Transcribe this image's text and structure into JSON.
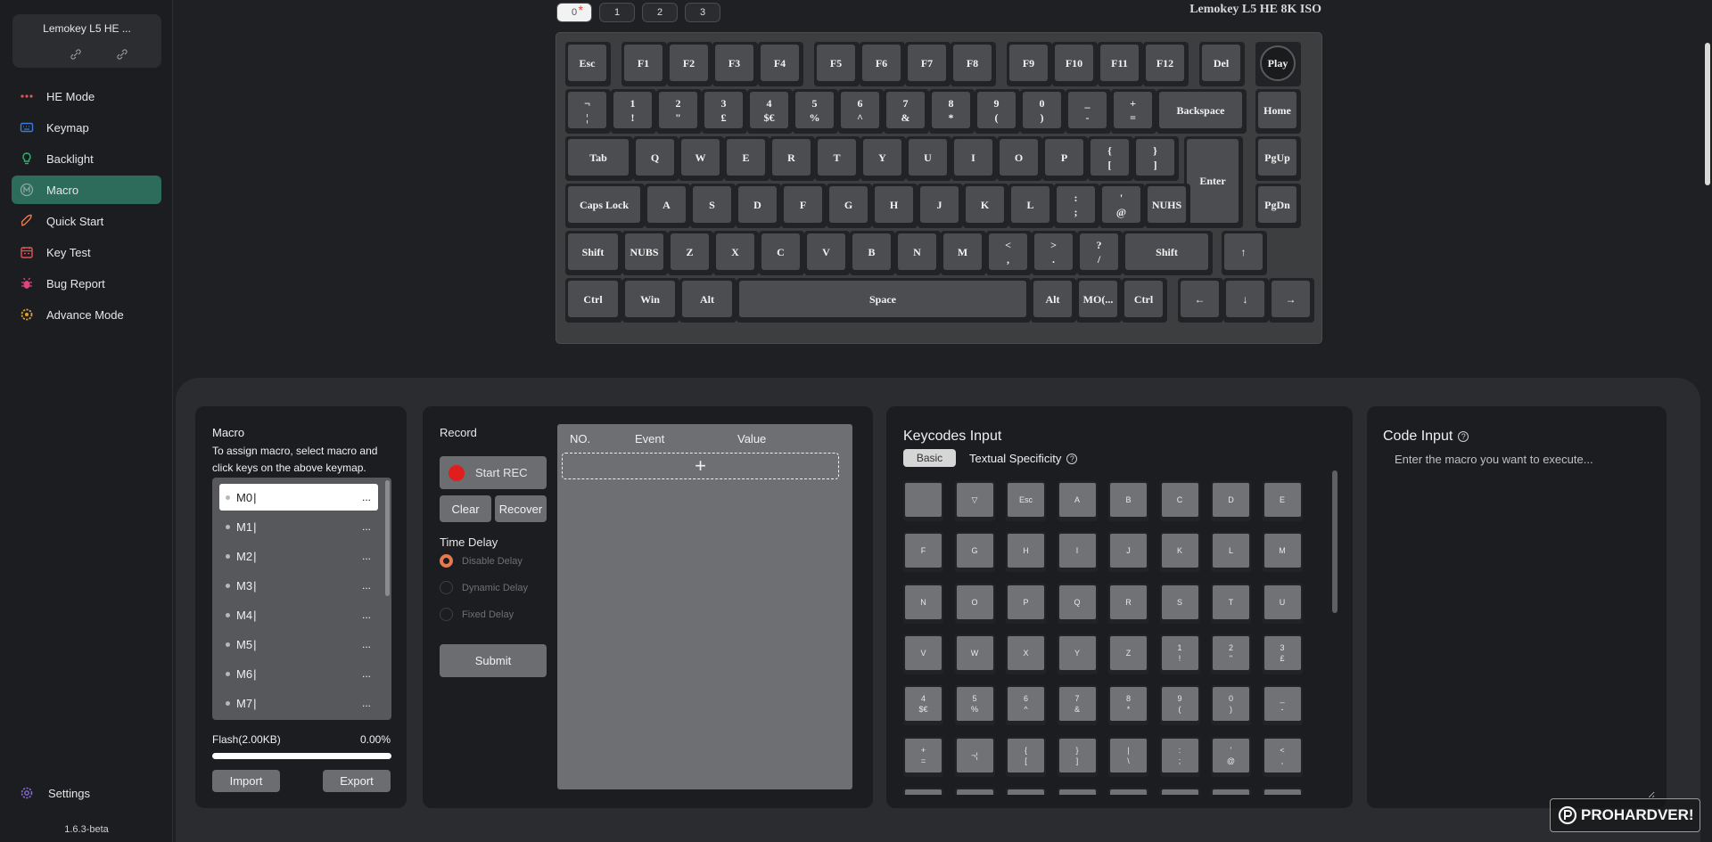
{
  "device": {
    "name": "Lemokey L5 HE ...",
    "link_icon": "link-icon",
    "unlink_icon": "unlink-icon"
  },
  "nav": [
    {
      "label": "HE Mode",
      "icon": "he-mode-icon",
      "color": "#e05555"
    },
    {
      "label": "Keymap",
      "icon": "keymap-icon",
      "color": "#3a7bd5"
    },
    {
      "label": "Backlight",
      "icon": "bulb-icon",
      "color": "#2fb36f"
    },
    {
      "label": "Macro",
      "icon": "macro-icon",
      "color": "#8da89f",
      "active": true
    },
    {
      "label": "Quick Start",
      "icon": "rocket-icon",
      "color": "#e8784e"
    },
    {
      "label": "Key Test",
      "icon": "key-test-icon",
      "color": "#e05555"
    },
    {
      "label": "Bug Report",
      "icon": "bug-icon",
      "color": "#e0447a"
    },
    {
      "label": "Advance Mode",
      "icon": "advance-gear-icon",
      "color": "#e0a030"
    }
  ],
  "settings": {
    "label": "Settings",
    "icon": "settings-icon",
    "color": "#8a6bd5"
  },
  "version": "1.6.3-beta",
  "layers": [
    {
      "label": "0",
      "active": true,
      "modified": true
    },
    {
      "label": "1"
    },
    {
      "label": "2"
    },
    {
      "label": "3"
    }
  ],
  "keyboard_title": "Lemokey L5 HE 8K ISO",
  "keys": [
    {
      "l": "Esc"
    },
    {
      "l": "F1"
    },
    {
      "l": "F2"
    },
    {
      "l": "F3"
    },
    {
      "l": "F4"
    },
    {
      "l": "F5"
    },
    {
      "l": "F6"
    },
    {
      "l": "F7"
    },
    {
      "l": "F8"
    },
    {
      "l": "F9"
    },
    {
      "l": "F10"
    },
    {
      "l": "F11"
    },
    {
      "l": "F12"
    },
    {
      "l": "Del"
    },
    {
      "l": "Play"
    },
    {
      "t": "¬",
      "b": "¦"
    },
    {
      "t": "1",
      "b": "!"
    },
    {
      "t": "2",
      "b": "\""
    },
    {
      "t": "3",
      "b": "£"
    },
    {
      "t": "4",
      "b": "$€"
    },
    {
      "t": "5",
      "b": "%"
    },
    {
      "t": "6",
      "b": "^"
    },
    {
      "t": "7",
      "b": "&"
    },
    {
      "t": "8",
      "b": "*"
    },
    {
      "t": "9",
      "b": "("
    },
    {
      "t": "0",
      "b": ")"
    },
    {
      "t": "_",
      "b": "-"
    },
    {
      "t": "+",
      "b": "="
    },
    {
      "l": "Backspace"
    },
    {
      "l": "Home"
    },
    {
      "l": "Tab"
    },
    {
      "l": "Q"
    },
    {
      "l": "W"
    },
    {
      "l": "E"
    },
    {
      "l": "R"
    },
    {
      "l": "T"
    },
    {
      "l": "Y"
    },
    {
      "l": "U"
    },
    {
      "l": "I"
    },
    {
      "l": "O"
    },
    {
      "l": "P"
    },
    {
      "t": "{",
      "b": "["
    },
    {
      "t": "}",
      "b": "]"
    },
    {
      "l": "Enter"
    },
    {
      "l": "PgUp"
    },
    {
      "l": "Caps Lock"
    },
    {
      "l": "A"
    },
    {
      "l": "S"
    },
    {
      "l": "D"
    },
    {
      "l": "F"
    },
    {
      "l": "G"
    },
    {
      "l": "H"
    },
    {
      "l": "J"
    },
    {
      "l": "K"
    },
    {
      "l": "L"
    },
    {
      "t": ":",
      "b": ";"
    },
    {
      "t": "'",
      "b": "@"
    },
    {
      "l": "NUHS"
    },
    {
      "l": "PgDn"
    },
    {
      "l": "Shift"
    },
    {
      "l": "NUBS"
    },
    {
      "l": "Z"
    },
    {
      "l": "X"
    },
    {
      "l": "C"
    },
    {
      "l": "V"
    },
    {
      "l": "B"
    },
    {
      "l": "N"
    },
    {
      "l": "M"
    },
    {
      "t": "<",
      "b": ","
    },
    {
      "t": ">",
      "b": "."
    },
    {
      "t": "?",
      "b": "/"
    },
    {
      "l": "Shift"
    },
    {
      "l": "↑"
    },
    {
      "l": "Ctrl"
    },
    {
      "l": "Win"
    },
    {
      "l": "Alt"
    },
    {
      "l": "Space"
    },
    {
      "l": "Alt"
    },
    {
      "l": "MO(..."
    },
    {
      "l": "Ctrl"
    },
    {
      "l": "←"
    },
    {
      "l": "↓"
    },
    {
      "l": "→"
    }
  ],
  "macro": {
    "title": "Macro",
    "description": "To assign macro, select macro and click keys on the above keymap.",
    "items": [
      "M0",
      "M1",
      "M2",
      "M3",
      "M4",
      "M5",
      "M6",
      "M7"
    ],
    "more": "...",
    "flash_label": "Flash(2.00KB)",
    "flash_percent": "0.00%",
    "flash_used": 0,
    "import_label": "Import",
    "export_label": "Export"
  },
  "record": {
    "title": "Record",
    "start_label": "Start REC",
    "clear_label": "Clear",
    "recover_label": "Recover",
    "delay_title": "Time Delay",
    "delay_options": [
      {
        "label": "Disable Delay",
        "checked": true
      },
      {
        "label": "Dynamic Delay"
      },
      {
        "label": "Fixed Delay"
      }
    ],
    "submit_label": "Submit",
    "table_headers": [
      "NO.",
      "Event",
      "Value"
    ],
    "add_label": "+"
  },
  "keycodes": {
    "title": "Keycodes Input",
    "tab_basic": "Basic",
    "tab_textual": "Textual Specificity",
    "help": "?",
    "items": [
      {
        "l": ""
      },
      {
        "l": "▽"
      },
      {
        "l": "Esc"
      },
      {
        "l": "A"
      },
      {
        "l": "B"
      },
      {
        "l": "C"
      },
      {
        "l": "D"
      },
      {
        "l": "E"
      },
      {
        "l": "F"
      },
      {
        "l": "G"
      },
      {
        "l": "H"
      },
      {
        "l": "I"
      },
      {
        "l": "J"
      },
      {
        "l": "K"
      },
      {
        "l": "L"
      },
      {
        "l": "M"
      },
      {
        "l": "N"
      },
      {
        "l": "O"
      },
      {
        "l": "P"
      },
      {
        "l": "Q"
      },
      {
        "l": "R"
      },
      {
        "l": "S"
      },
      {
        "l": "T"
      },
      {
        "l": "U"
      },
      {
        "l": "V"
      },
      {
        "l": "W"
      },
      {
        "l": "X"
      },
      {
        "l": "Y"
      },
      {
        "l": "Z"
      },
      {
        "t": "1",
        "b": "!"
      },
      {
        "t": "2",
        "b": "\""
      },
      {
        "t": "3",
        "b": "£"
      },
      {
        "t": "4",
        "b": "$€"
      },
      {
        "t": "5",
        "b": "%"
      },
      {
        "t": "6",
        "b": "^"
      },
      {
        "t": "7",
        "b": "&"
      },
      {
        "t": "8",
        "b": "*"
      },
      {
        "t": "9",
        "b": "("
      },
      {
        "t": "0",
        "b": ")"
      },
      {
        "t": "_",
        "b": "-"
      },
      {
        "t": "+",
        "b": "="
      },
      {
        "l": "¬¦"
      },
      {
        "t": "{",
        "b": "["
      },
      {
        "t": "}",
        "b": "]"
      },
      {
        "t": "|",
        "b": "\\"
      },
      {
        "t": ":",
        "b": ";"
      },
      {
        "t": "'",
        "b": "@"
      },
      {
        "t": "<",
        "b": ","
      },
      {
        "l": ""
      },
      {
        "l": ""
      },
      {
        "l": ""
      },
      {
        "l": ""
      },
      {
        "l": ""
      },
      {
        "l": ""
      },
      {
        "l": ""
      },
      {
        "l": ""
      }
    ]
  },
  "code": {
    "title": "Code Input",
    "help": "?",
    "placeholder": "Enter the macro you want to execute..."
  },
  "watermark": "PROHARDVER!"
}
